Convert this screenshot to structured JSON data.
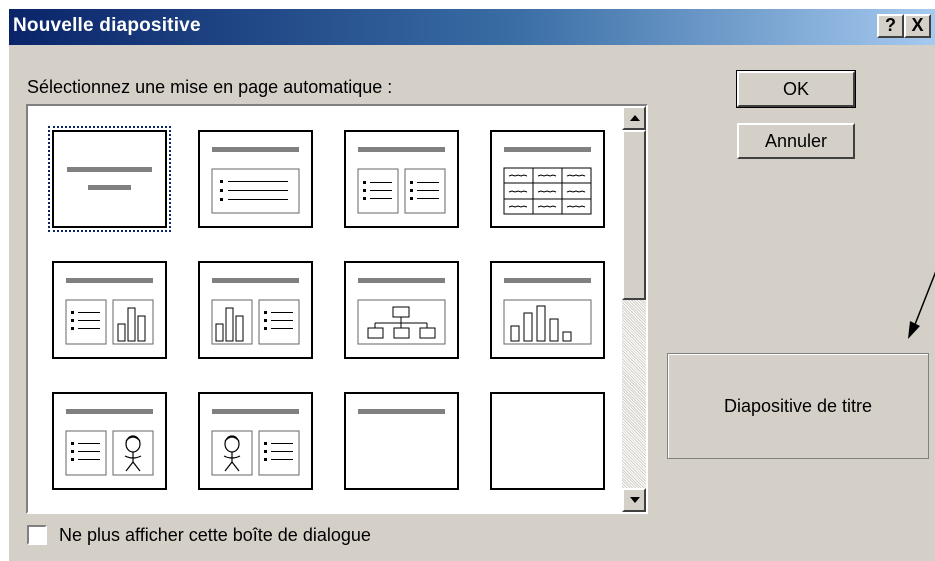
{
  "window": {
    "title": "Nouvelle diapositive",
    "help_button": "?",
    "close_button": "X"
  },
  "layout_prompt": "Sélectionnez une mise en page automatique :",
  "layouts": [
    {
      "name": "Diapositive de titre",
      "selected": true
    },
    {
      "name": "Liste à puces"
    },
    {
      "name": "Texte sur 2 colonnes"
    },
    {
      "name": "Tableau"
    },
    {
      "name": "Texte et graphique"
    },
    {
      "name": "Graphique et texte"
    },
    {
      "name": "Organigramme"
    },
    {
      "name": "Graphique"
    },
    {
      "name": "Texte et image"
    },
    {
      "name": "Image et texte"
    },
    {
      "name": "Titre seul"
    },
    {
      "name": "Vide"
    }
  ],
  "buttons": {
    "ok_label": "OK",
    "cancel_label": "Annuler"
  },
  "preview": {
    "label": "Diapositive de titre"
  },
  "checkbox": {
    "label": "Ne plus afficher cette boîte de dialogue",
    "checked": false
  },
  "scrollbar": {
    "position": 0
  },
  "colors": {
    "titlebar_start": "#0a246a",
    "titlebar_end": "#a6caf0",
    "dialog_bg": "#d4d0c8",
    "accent_bar": "#808080"
  }
}
